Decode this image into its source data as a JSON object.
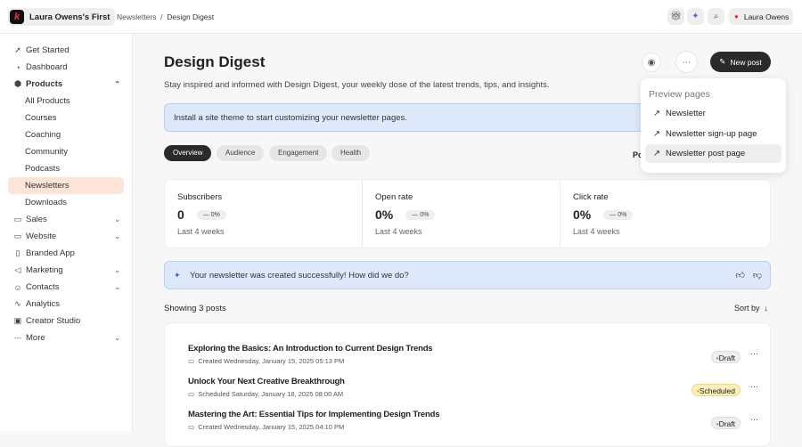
{
  "header": {
    "brand": "Laura Owens's First",
    "logo_letter": "k",
    "breadcrumb": [
      "Newsletters",
      "Design Digest"
    ],
    "user": "Laura Owens"
  },
  "sidebar": {
    "items": [
      {
        "label": "Get Started",
        "icon": "rocket-icon",
        "glyph": "➚"
      },
      {
        "label": "Dashboard",
        "icon": "dashboard-icon",
        "glyph": "◔"
      },
      {
        "label": "Products",
        "icon": "box-icon",
        "glyph": "⬢",
        "chev": "⌃"
      },
      {
        "label": "All Products",
        "sub": true
      },
      {
        "label": "Courses",
        "sub": true
      },
      {
        "label": "Coaching",
        "sub": true
      },
      {
        "label": "Community",
        "sub": true
      },
      {
        "label": "Podcasts",
        "sub": true
      },
      {
        "label": "Newsletters",
        "sub": true,
        "active": true
      },
      {
        "label": "Downloads",
        "sub": true
      },
      {
        "label": "Sales",
        "icon": "sales-icon",
        "glyph": "▭",
        "chev": "⌄"
      },
      {
        "label": "Website",
        "icon": "website-icon",
        "glyph": "▭",
        "chev": "⌄"
      },
      {
        "label": "Branded App",
        "icon": "phone-icon",
        "glyph": "▯"
      },
      {
        "label": "Marketing",
        "icon": "megaphone-icon",
        "glyph": "◁",
        "chev": "⌄"
      },
      {
        "label": "Contacts",
        "icon": "contacts-icon",
        "glyph": "☺",
        "chev": "⌄"
      },
      {
        "label": "Analytics",
        "icon": "analytics-icon",
        "glyph": "∿"
      },
      {
        "label": "Creator Studio",
        "icon": "studio-icon",
        "glyph": "▣"
      },
      {
        "label": "More",
        "icon": "more-icon",
        "glyph": "⋯",
        "chev": "⌄"
      }
    ]
  },
  "page": {
    "title": "Design Digest",
    "subtitle": "Stay inspired and informed with Design Digest, your weekly dose of the latest trends, tips, and insights.",
    "new_post": "New post",
    "theme_banner": "Install a site theme to start customizing your newsletter pages.",
    "posts_label_partial": "Po"
  },
  "tabs": [
    "Overview",
    "Audience",
    "Engagement",
    "Health"
  ],
  "stats": [
    {
      "title": "Subscribers",
      "value": "0",
      "change": "0%",
      "period": "Last 4 weeks"
    },
    {
      "title": "Open rate",
      "value": "0%",
      "change": "0%",
      "period": "Last 4 weeks"
    },
    {
      "title": "Click rate",
      "value": "0%",
      "change": "0%",
      "period": "Last 4 weeks"
    }
  ],
  "feedback": "Your newsletter was created successfully! How did we do?",
  "showing": "Showing 3 posts",
  "sort": "Sort by",
  "posts": [
    {
      "title": "Exploring the Basics: An Introduction to Current Design Trends",
      "date": "Created Wednesday, January 15, 2025 05:13 PM",
      "status": "Draft"
    },
    {
      "title": "Unlock Your Next Creative Breakthrough",
      "date": "Scheduled Saturday, January 18, 2025 08:00 AM",
      "status": "Scheduled"
    },
    {
      "title": "Mastering the Art: Essential Tips for Implementing Design Trends",
      "date": "Created Wednesday, January 15, 2025 04:10 PM",
      "status": "Draft"
    }
  ],
  "dropdown": {
    "heading": "Preview pages",
    "items": [
      "Newsletter",
      "Newsletter sign-up page",
      "Newsletter post page"
    ]
  }
}
